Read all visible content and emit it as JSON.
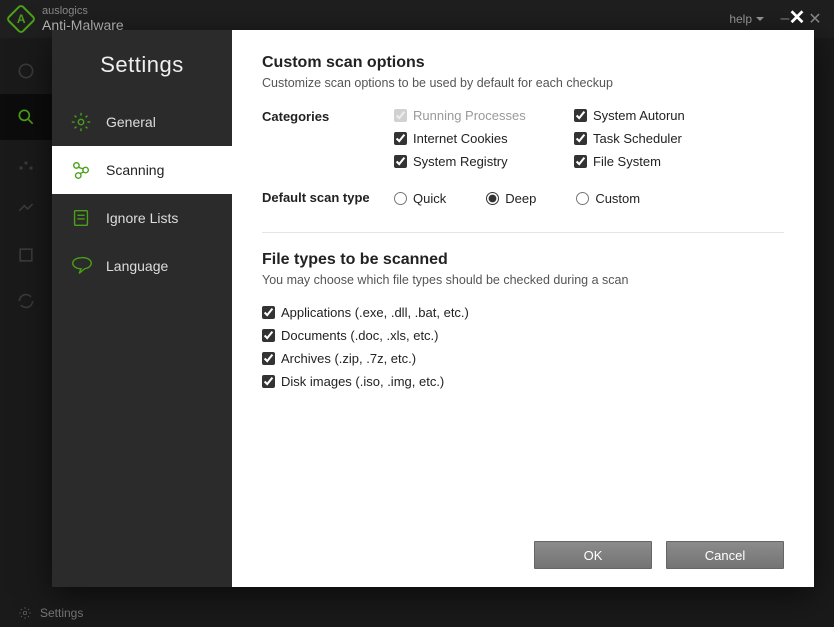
{
  "titlebar": {
    "brand": "auslogics",
    "product": "Anti-Malware",
    "help": "help"
  },
  "statusbar": {
    "settings": "Settings"
  },
  "settings": {
    "title": "Settings",
    "nav": {
      "general": "General",
      "scanning": "Scanning",
      "ignore": "Ignore Lists",
      "language": "Language"
    }
  },
  "scan": {
    "heading": "Custom scan options",
    "sub": "Customize scan options to be used by default for each checkup",
    "categories_label": "Categories",
    "categories": {
      "running": "Running Processes",
      "autorun": "System Autorun",
      "cookies": "Internet Cookies",
      "task": "Task Scheduler",
      "registry": "System Registry",
      "filesystem": "File System"
    },
    "scantype_label": "Default scan type",
    "scantype": {
      "quick": "Quick",
      "deep": "Deep",
      "custom": "Custom"
    }
  },
  "filetypes": {
    "heading": "File types to be scanned",
    "sub": "You may choose which file types should be checked during a scan",
    "apps": "Applications (.exe, .dll, .bat, etc.)",
    "docs": "Documents (.doc, .xls, etc.)",
    "archives": "Archives (.zip, .7z, etc.)",
    "disk": "Disk images (.iso, .img, etc.)"
  },
  "buttons": {
    "ok": "OK",
    "cancel": "Cancel"
  }
}
